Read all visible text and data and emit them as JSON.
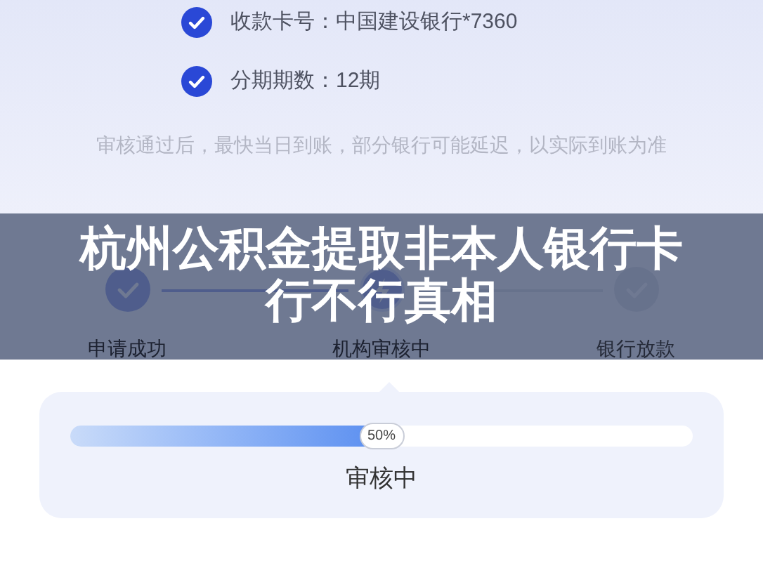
{
  "details": [
    {
      "label": "收款卡号：中国建设银行*7360",
      "checked": true
    },
    {
      "label": "分期期数：12期",
      "checked": true
    }
  ],
  "note": "审核通过后，最快当日到账，部分银行可能延迟，以实际到账为准",
  "steps": [
    {
      "label": "申请成功",
      "completed": true,
      "selected": false
    },
    {
      "label": "机构审核中",
      "completed": false,
      "selected": true
    },
    {
      "label": "银行放款",
      "completed": false,
      "selected": false
    }
  ],
  "progress": {
    "level": 0.5,
    "reading": "50%",
    "status": "审核中"
  },
  "headline": "杭州公积金提取非本人银行卡行不行真相"
}
